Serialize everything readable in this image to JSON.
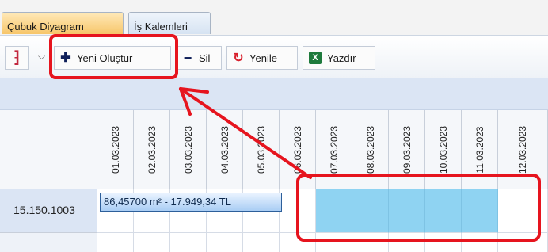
{
  "tabs": [
    {
      "label": "Çubuk Diyagram",
      "active": true
    },
    {
      "label": "İş Kalemleri",
      "active": false
    }
  ],
  "toolbar": {
    "view_icon": "chart-view-icon",
    "buttons": [
      {
        "id": "new",
        "label": "Yeni Oluştur",
        "icon": "plus-icon"
      },
      {
        "id": "delete",
        "label": "Sil",
        "icon": "minus-icon"
      },
      {
        "id": "refresh",
        "label": "Yenile",
        "icon": "refresh-icon"
      },
      {
        "id": "print",
        "label": "Yazdır",
        "icon": "excel-icon"
      }
    ]
  },
  "grid": {
    "dates": [
      "01.03.2023",
      "02.03.2023",
      "03.03.2023",
      "04.03.2023",
      "05.03.2023",
      "06.03.2023",
      "07.03.2023",
      "08.03.2023",
      "09.03.2023",
      "10.03.2023",
      "11.03.2023",
      "12.03.2023"
    ],
    "row_label": "15.150.1003",
    "bar_text": "86,45700 m² - 17.949,34 TL",
    "highlighted_columns": [
      6,
      7,
      8,
      9,
      10
    ]
  },
  "colors": {
    "annotation": "#e6141e",
    "highlight": "#8fd3f2",
    "active_tab": "#f7c66a"
  }
}
